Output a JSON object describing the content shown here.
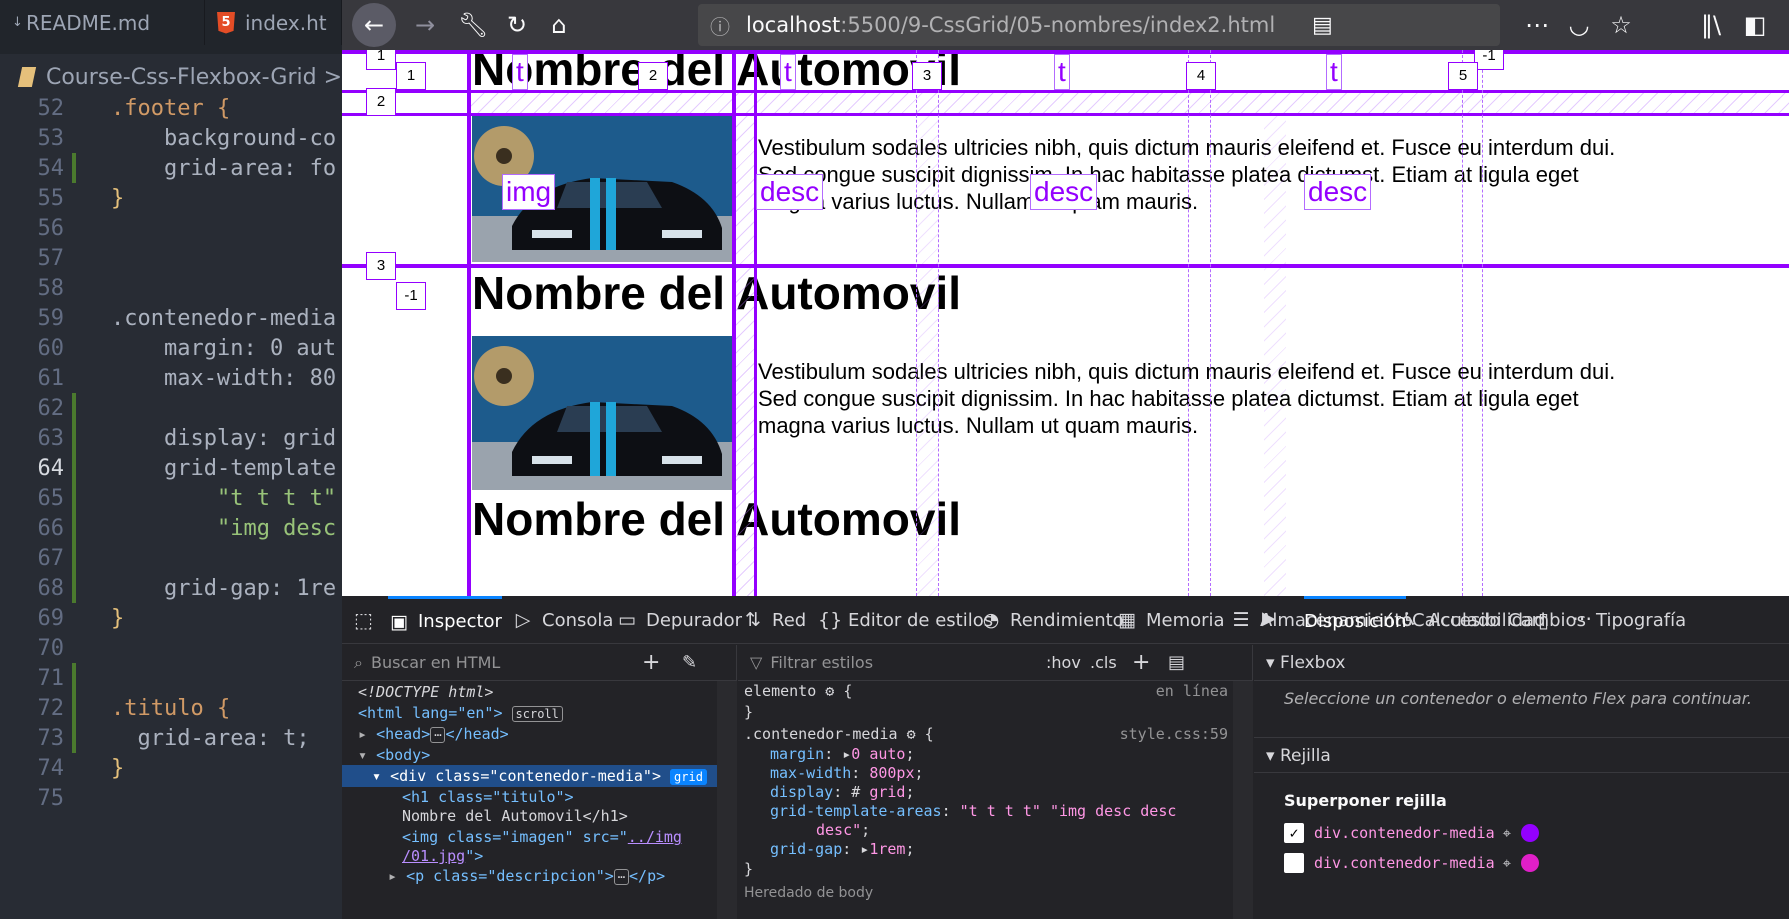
{
  "editor": {
    "tabs": [
      {
        "label": "README.md"
      },
      {
        "label": "index.ht"
      }
    ],
    "breadcrumb": "Course-Css-Flexbox-Grid >",
    "lines": [
      {
        "num": "52",
        "text": ".footer {"
      },
      {
        "num": "53",
        "text": "    background-co"
      },
      {
        "num": "54",
        "text": "    grid-area: fo"
      },
      {
        "num": "55",
        "text": "}"
      },
      {
        "num": "56",
        "text": ""
      },
      {
        "num": "57",
        "text": ""
      },
      {
        "num": "58",
        "text": ""
      },
      {
        "num": "59",
        "text": ".contenedor-media"
      },
      {
        "num": "60",
        "text": "    margin: 0 aut"
      },
      {
        "num": "61",
        "text": "    max-width: 80"
      },
      {
        "num": "62",
        "text": ""
      },
      {
        "num": "63",
        "text": "    display: grid"
      },
      {
        "num": "64",
        "text": "    grid-template"
      },
      {
        "num": "65",
        "text": "        \"t t t t\""
      },
      {
        "num": "66",
        "text": "        \"img desc"
      },
      {
        "num": "67",
        "text": ""
      },
      {
        "num": "68",
        "text": "    grid-gap: 1re"
      },
      {
        "num": "69",
        "text": "}"
      },
      {
        "num": "70",
        "text": ""
      },
      {
        "num": "71",
        "text": ""
      },
      {
        "num": "72",
        "text": ".titulo {"
      },
      {
        "num": "73",
        "text": "  grid-area: t;"
      },
      {
        "num": "74",
        "text": "}"
      },
      {
        "num": "75",
        "text": ""
      }
    ]
  },
  "browser": {
    "url_host": "localhost",
    "url_path": ":5500/9-CssGrid/05-nombres/index2.html",
    "icons": [
      "back-arrow-icon",
      "forward-arrow-icon",
      "wrench-icon",
      "reload-icon",
      "home-icon",
      "info-icon",
      "reader-view-icon",
      "more-icon",
      "pocket-icon",
      "star-icon",
      "library-icon",
      "sidebar-icon",
      "account-icon"
    ]
  },
  "page": {
    "items": [
      {
        "title": "Nombre del Automovil",
        "img_alt": "car",
        "desc": "Vestibulum sodales ultricies nibh, quis dictum mauris eleifend et. Fusce eu interdum dui. Sed congue suscipit dignissim. In hac habitasse platea dictumst. Etiam at ligula eget magna varius luctus. Nullam ut quam mauris."
      },
      {
        "title": "Nombre del Automovil",
        "img_alt": "car",
        "desc": "Vestibulum sodales ultricies nibh, quis dictum mauris eleifend et. Fusce eu interdum dui. Sed congue suscipit dignissim. In hac habitasse platea dictumst. Etiam at ligula eget magna varius luctus. Nullam ut quam mauris."
      },
      {
        "title": "Nombre del Automovil"
      }
    ],
    "grid_overlay": {
      "col_numbers": [
        "1",
        "2",
        "3",
        "4",
        "5"
      ],
      "row_numbers": [
        "1",
        "2",
        "3",
        "-1"
      ],
      "corner_numbers": [
        "1",
        "-1"
      ],
      "area_labels": [
        "t",
        "t",
        "t",
        "t",
        "img",
        "desc",
        "desc",
        "desc"
      ]
    }
  },
  "devtools": {
    "tabs": [
      {
        "label": "Inspector",
        "icon": "inspector-icon"
      },
      {
        "label": "Consola",
        "icon": "console-icon"
      },
      {
        "label": "Depurador",
        "icon": "debugger-icon"
      },
      {
        "label": "Red",
        "icon": "network-icon"
      },
      {
        "label": "Editor de estilos",
        "icon": "style-editor-icon"
      },
      {
        "label": "Rendimiento",
        "icon": "performance-icon"
      },
      {
        "label": "Memoria",
        "icon": "memory-icon"
      },
      {
        "label": "Almacenamiento",
        "icon": "storage-icon"
      },
      {
        "label": "Accesibilidad",
        "icon": "accessibility-icon"
      }
    ],
    "markup_search_placeholder": "Buscar en HTML",
    "markup": {
      "doctype": "<!DOCTYPE html>",
      "html_open": "<html lang=\"en\">",
      "scroll_badge": "scroll",
      "head": "<head>",
      "head_close": "</head>",
      "body": "<body>",
      "div": "<div class=\"contenedor-media\">",
      "grid_badge": "grid",
      "h1_open": "<h1 class=\"titulo\">",
      "h1_text": "Nombre del Automovil</h1>",
      "img_line1": "<img class=\"imagen\" src=\"",
      "img_src": "../img",
      "img_src2": "/01.jpg",
      "img_close": "\">",
      "p_line": "<p class=\"descripcion\">",
      "p_close": "</p>"
    },
    "rules_filter_placeholder": "Filtrar estilos",
    "rules_hov": ":hov",
    "rules_cls": ".cls",
    "rules": {
      "element_sel": "elemento",
      "element_src": "en línea",
      "media_sel": ".contenedor-media",
      "media_src": "style.css:59",
      "decls": [
        {
          "prop": "margin",
          "val": "0 auto"
        },
        {
          "prop": "max-width",
          "val": "800px"
        },
        {
          "prop": "display",
          "val": "grid"
        },
        {
          "prop": "grid-template-areas",
          "val": "\"t t t t\" \"img desc desc"
        },
        {
          "prop": "",
          "val": "desc\""
        },
        {
          "prop": "grid-gap",
          "val": "1rem"
        }
      ],
      "inherited": "Heredado de body"
    },
    "layout": {
      "tabs": [
        "Disposición",
        "Calculado",
        "Cambios",
        "Tipografía"
      ],
      "flexbox_title": "Flexbox",
      "flexbox_hint": "Seleccione un contenedor o elemento Flex para continuar.",
      "grid_title": "Rejilla",
      "overlay_label": "Superponer rejilla",
      "overlays": [
        {
          "name": "div.contenedor-media",
          "color": "#9400ff",
          "checked": true
        },
        {
          "name": "div.contenedor-media",
          "color": "#e01fc8",
          "checked": false
        }
      ]
    }
  }
}
